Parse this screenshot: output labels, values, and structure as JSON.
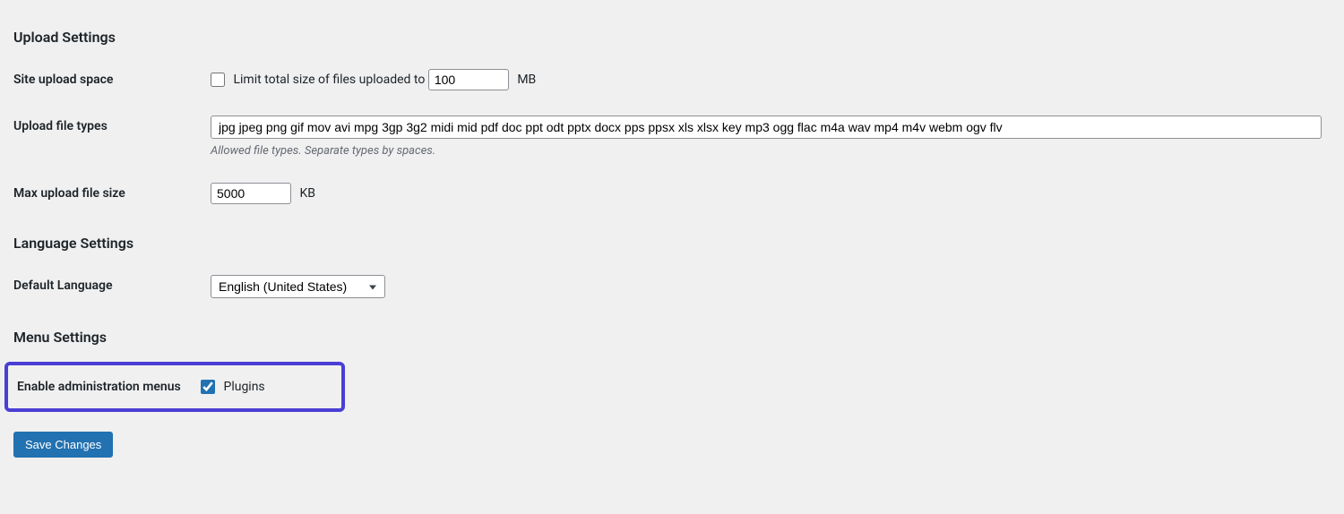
{
  "upload_section": {
    "heading": "Upload Settings",
    "site_space_label": "Site upload space",
    "site_space_checkbox_text": "Limit total size of files uploaded to",
    "site_space_value": "100",
    "site_space_unit": "MB",
    "file_types_label": "Upload file types",
    "file_types_value": "jpg jpeg png gif mov avi mpg 3gp 3g2 midi mid pdf doc ppt odt pptx docx pps ppsx xls xlsx key mp3 ogg flac m4a wav mp4 m4v webm ogv flv",
    "file_types_description": "Allowed file types. Separate types by spaces.",
    "max_size_label": "Max upload file size",
    "max_size_value": "5000",
    "max_size_unit": "KB"
  },
  "language_section": {
    "heading": "Language Settings",
    "default_lang_label": "Default Language",
    "default_lang_value": "English (United States)"
  },
  "menu_section": {
    "heading": "Menu Settings",
    "enable_admin_label": "Enable administration menus",
    "plugins_label": "Plugins"
  },
  "save_button": "Save Changes"
}
